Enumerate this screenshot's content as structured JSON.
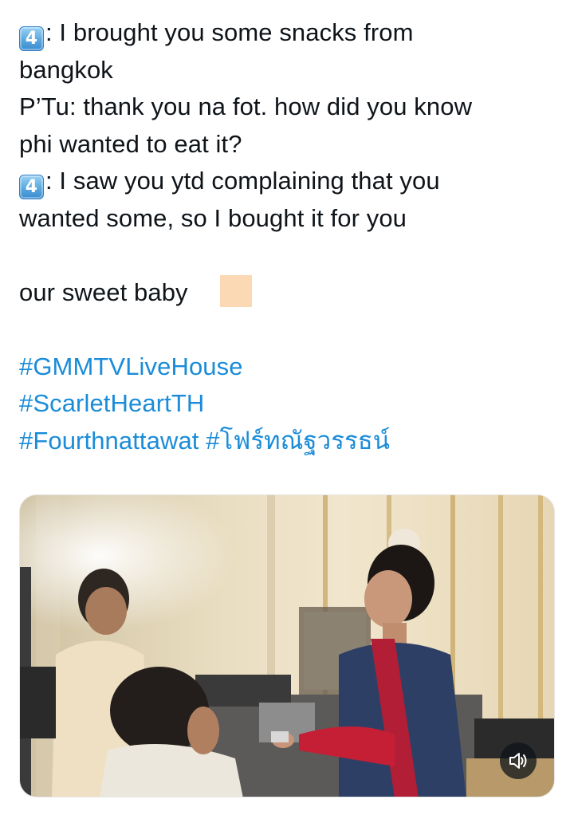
{
  "tweet": {
    "lines": {
      "l1_emoji": "4",
      "l1_text": ": I brought you some snacks from",
      "l2_text": "bangkok",
      "l3_text": "P’Tu: thank you na fot. how did you know",
      "l4_text": "phi wanted to eat it?",
      "l5_emoji": "4",
      "l5_text": ": I saw you ytd complaining that you",
      "l6_text": "wanted some, so I bought it for you",
      "l8_text": "our sweet baby"
    },
    "hashtags": [
      "#GMMTVLiveHouse",
      "#ScarletHeartTH",
      "#Fourthnattawat",
      "#โฟร์ทณัฐวรรธน์"
    ],
    "hashtag_color": "#1a8cd8",
    "emoji_block_color": "#fbd9b4"
  },
  "media": {
    "type": "video",
    "mute_button_icon": "speaker-muted-icon"
  }
}
